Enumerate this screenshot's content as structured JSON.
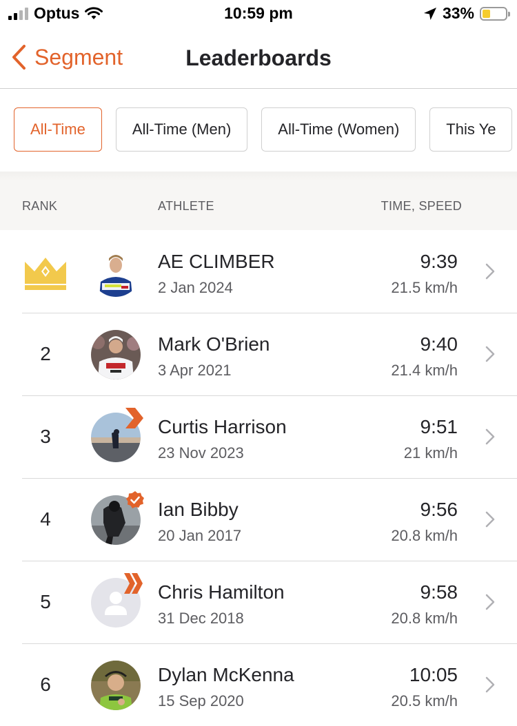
{
  "status_bar": {
    "carrier": "Optus",
    "time": "10:59 pm",
    "battery_percent": "33%",
    "battery_level": 0.33,
    "signal_bars_filled": 2
  },
  "nav": {
    "back_label": "Segment",
    "title": "Leaderboards"
  },
  "filters": [
    {
      "label": "All-Time",
      "active": true
    },
    {
      "label": "All-Time (Men)",
      "active": false
    },
    {
      "label": "All-Time (Women)",
      "active": false
    },
    {
      "label": "This Ye",
      "active": false
    }
  ],
  "columns": {
    "rank": "RANK",
    "athlete": "ATHLETE",
    "time_speed": "TIME, SPEED"
  },
  "rows": [
    {
      "rank": "1",
      "crown": true,
      "name": "AE CLIMBER",
      "date": "2 Jan 2024",
      "time": "9:39",
      "speed": "21.5 km/h",
      "badge": "none",
      "avatar": "photo"
    },
    {
      "rank": "2",
      "crown": false,
      "name": "Mark O'Brien",
      "date": "3 Apr 2021",
      "time": "9:40",
      "speed": "21.4 km/h",
      "badge": "none",
      "avatar": "photo"
    },
    {
      "rank": "3",
      "crown": false,
      "name": "Curtis Harrison",
      "date": "23 Nov 2023",
      "time": "9:51",
      "speed": "21 km/h",
      "badge": "subscriber-chevron-icon",
      "avatar": "photo"
    },
    {
      "rank": "4",
      "crown": false,
      "name": "Ian Bibby",
      "date": "20 Jan 2017",
      "time": "9:56",
      "speed": "20.8 km/h",
      "badge": "verified-icon",
      "avatar": "photo"
    },
    {
      "rank": "5",
      "crown": false,
      "name": "Chris Hamilton",
      "date": "31 Dec 2018",
      "time": "9:58",
      "speed": "20.8 km/h",
      "badge": "double-chevron-icon",
      "avatar": "placeholder"
    },
    {
      "rank": "6",
      "crown": false,
      "name": "Dylan McKenna",
      "date": "15 Sep 2020",
      "time": "10:05",
      "speed": "20.5 km/h",
      "badge": "none",
      "avatar": "photo"
    }
  ],
  "colors": {
    "accent": "#e2632b",
    "crown": "#f2c94c",
    "text": "#242428",
    "secondary_text": "#5c5c60",
    "header_bg": "#f7f6f4"
  }
}
